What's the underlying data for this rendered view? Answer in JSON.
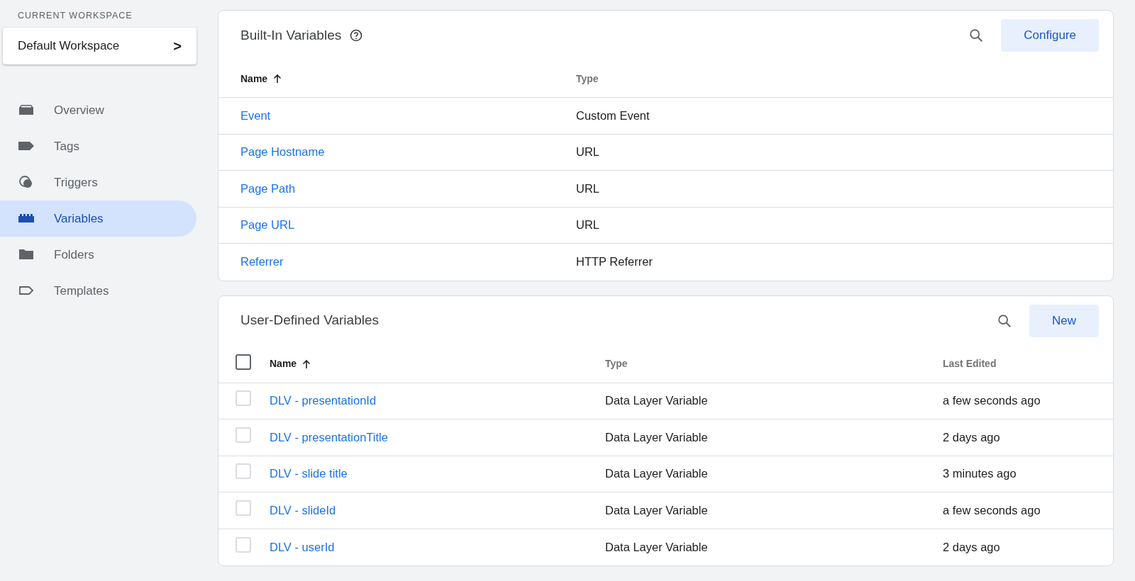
{
  "sidebar": {
    "workspace_label": "CURRENT WORKSPACE",
    "workspace_button": {
      "label": "Default Workspace",
      "chevron": ">"
    },
    "items": [
      {
        "kind": "overview",
        "label": "Overview",
        "selected": false
      },
      {
        "kind": "tags",
        "label": "Tags",
        "selected": false
      },
      {
        "kind": "triggers",
        "label": "Triggers",
        "selected": false
      },
      {
        "kind": "variables",
        "label": "Variables",
        "selected": true
      },
      {
        "kind": "folders",
        "label": "Folders",
        "selected": false
      },
      {
        "kind": "templates",
        "label": "Templates",
        "selected": false
      }
    ]
  },
  "built_in": {
    "title": "Built-In Variables",
    "button": "Configure",
    "columns": [
      "Name",
      "Type"
    ],
    "rows": [
      {
        "name": "Event",
        "type": "Custom Event"
      },
      {
        "name": "Page Hostname",
        "type": "URL"
      },
      {
        "name": "Page Path",
        "type": "URL"
      },
      {
        "name": "Page URL",
        "type": "URL"
      },
      {
        "name": "Referrer",
        "type": "HTTP Referrer"
      }
    ]
  },
  "user_defined": {
    "title": "User-Defined Variables",
    "button": "New",
    "select_all_checked": false,
    "columns": [
      "Name",
      "Type",
      "Last Edited"
    ],
    "rows": [
      {
        "name": "DLV - presentationId",
        "type": "Data Layer Variable",
        "last_edited": "a few seconds ago",
        "checked": false
      },
      {
        "name": "DLV - presentationTitle",
        "type": "Data Layer Variable",
        "last_edited": "2 days ago",
        "checked": false
      },
      {
        "name": "DLV - slide title",
        "type": "Data Layer Variable",
        "last_edited": "3 minutes ago",
        "checked": false
      },
      {
        "name": "DLV - slideId",
        "type": "Data Layer Variable",
        "last_edited": "a few seconds ago",
        "checked": false
      },
      {
        "name": "DLV - userId",
        "type": "Data Layer Variable",
        "last_edited": "2 days ago",
        "checked": false
      }
    ]
  }
}
